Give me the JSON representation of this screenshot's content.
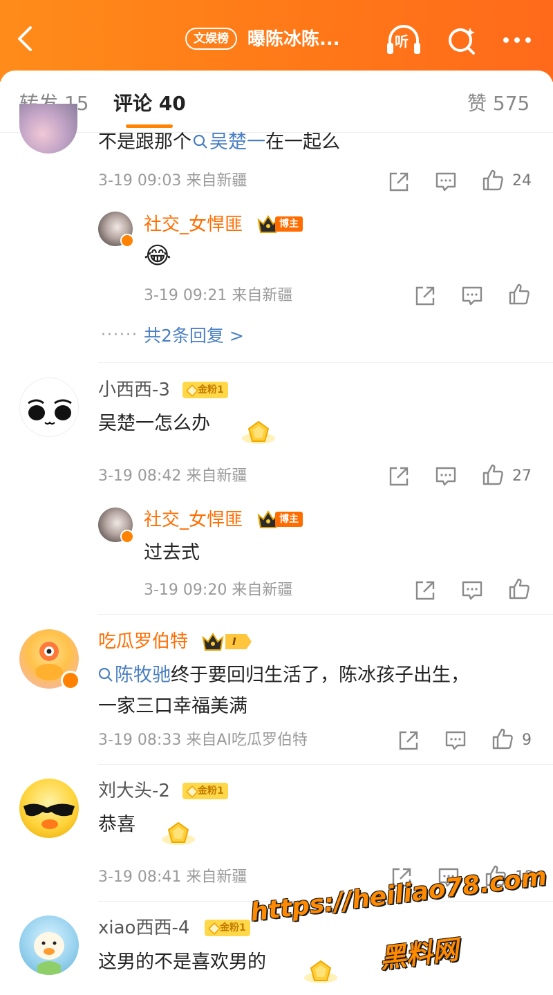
{
  "header": {
    "back_icon": "chevron-left-icon",
    "tag": "文娱榜",
    "title": "曝陈冰陈...",
    "listen_label": "听",
    "search_icon": "search-sparkle-icon",
    "more_icon": "more-dots-icon"
  },
  "tabs": {
    "repost": "转发 15",
    "comments": "评论 40",
    "likes": "赞 575"
  },
  "comments": [
    {
      "text_pre": "不是跟那个",
      "text_link": "吴楚一",
      "text_post": "在一起么",
      "time_source": "3-19 09:03  来自新疆",
      "likes": "24",
      "reply": {
        "name": "社交_女悍匪",
        "badge": "博主",
        "emoji": "😂",
        "time_source": "3-19 09:21  来自新疆"
      },
      "more_replies": "共2条回复 >"
    },
    {
      "name": "小西西-3",
      "fan_badge": "金粉1",
      "text": "吴楚一怎么办",
      "time_source": "3-19 08:42  来自新疆",
      "likes": "27",
      "reply": {
        "name": "社交_女悍匪",
        "badge": "博主",
        "text": "过去式",
        "time_source": "3-19 09:20  来自新疆"
      }
    },
    {
      "name": "吃瓜罗伯特",
      "vip_level": "I",
      "text_link": "陈牧驰",
      "text_line1": "终于要回归生活了，陈冰孩子出生，",
      "text_line2": "一家三口幸福美满",
      "time_source": "3-19 08:33  来自AI吃瓜罗伯特",
      "likes": "9"
    },
    {
      "name": "刘大头-2",
      "fan_badge": "金粉1",
      "text": "恭喜",
      "time_source": "3-19 08:41  来自新疆",
      "likes": "12"
    },
    {
      "name": "xiao西西-4",
      "fan_badge": "金粉1",
      "text": "这男的不是喜欢男的"
    }
  ],
  "watermark": {
    "line1": "https://heiliao78.com",
    "line2": "黑料网"
  },
  "colors": {
    "brand_orange": "#ff8200",
    "link_blue": "#4a7fc1",
    "name_orange": "#ff6d00"
  }
}
